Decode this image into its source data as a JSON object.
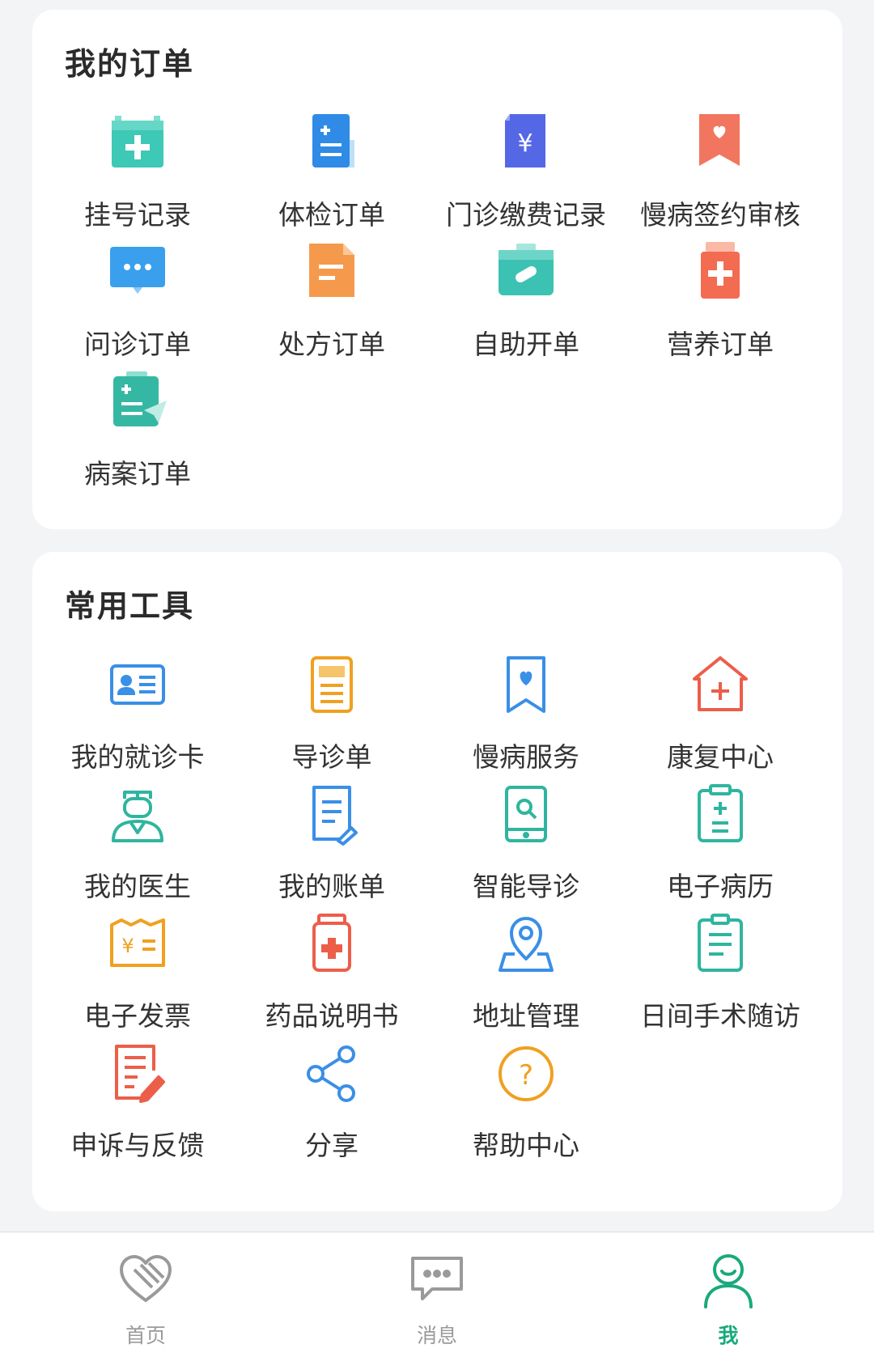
{
  "orders": {
    "title": "我的订单",
    "items": [
      {
        "label": "挂号记录",
        "icon": "registration-record-icon"
      },
      {
        "label": "体检订单",
        "icon": "checkup-order-icon"
      },
      {
        "label": "门诊缴费记录",
        "icon": "outpatient-payment-icon"
      },
      {
        "label": "慢病签约审核",
        "icon": "chronic-contract-icon"
      },
      {
        "label": "问诊订单",
        "icon": "consultation-order-icon"
      },
      {
        "label": "处方订单",
        "icon": "prescription-order-icon"
      },
      {
        "label": "自助开单",
        "icon": "self-service-order-icon"
      },
      {
        "label": "营养订单",
        "icon": "nutrition-order-icon"
      },
      {
        "label": "病案订单",
        "icon": "medical-record-order-icon"
      }
    ]
  },
  "tools": {
    "title": "常用工具",
    "items": [
      {
        "label": "我的就诊卡",
        "icon": "medical-card-icon"
      },
      {
        "label": "导诊单",
        "icon": "guide-sheet-icon"
      },
      {
        "label": "慢病服务",
        "icon": "chronic-service-icon"
      },
      {
        "label": "康复中心",
        "icon": "rehab-center-icon"
      },
      {
        "label": "我的医生",
        "icon": "doctor-icon"
      },
      {
        "label": "我的账单",
        "icon": "bill-icon"
      },
      {
        "label": "智能导诊",
        "icon": "smart-guide-icon"
      },
      {
        "label": "电子病历",
        "icon": "emr-icon"
      },
      {
        "label": "电子发票",
        "icon": "e-invoice-icon"
      },
      {
        "label": "药品说明书",
        "icon": "drug-manual-icon"
      },
      {
        "label": "地址管理",
        "icon": "address-icon"
      },
      {
        "label": "日间手术随访",
        "icon": "day-surgery-followup-icon"
      },
      {
        "label": "申诉与反馈",
        "icon": "feedback-icon"
      },
      {
        "label": "分享",
        "icon": "share-icon"
      },
      {
        "label": "帮助中心",
        "icon": "help-icon"
      }
    ]
  },
  "tabbar": {
    "items": [
      {
        "label": "首页",
        "icon": "home-heart-icon",
        "active": false
      },
      {
        "label": "消息",
        "icon": "message-icon",
        "active": false
      },
      {
        "label": "我",
        "icon": "profile-icon",
        "active": true
      }
    ]
  },
  "colors": {
    "accent": "#1aa97c",
    "inactive": "#9a9a9a"
  }
}
